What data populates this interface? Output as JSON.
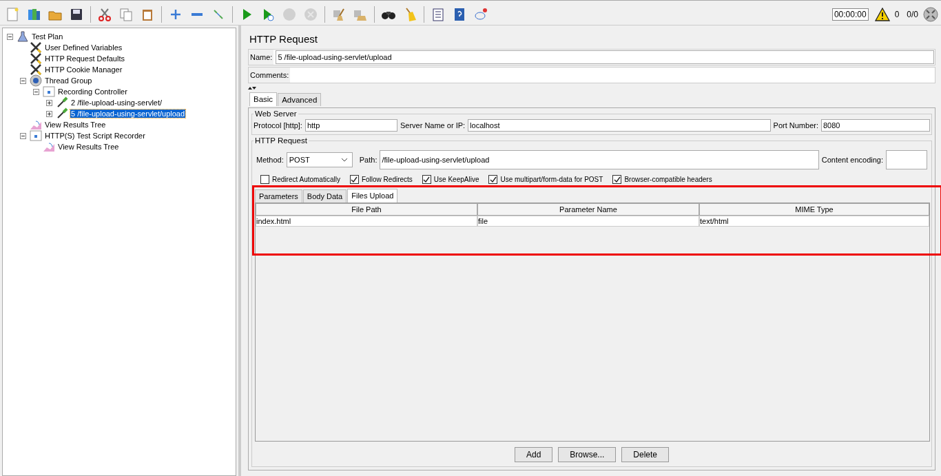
{
  "toolbar": {
    "buttons": [
      {
        "kind": "new",
        "disabled": false
      },
      {
        "kind": "templates",
        "disabled": false
      },
      {
        "kind": "open",
        "disabled": false
      },
      {
        "kind": "save",
        "disabled": false
      },
      {
        "kind": "separator"
      },
      {
        "kind": "cut",
        "disabled": false
      },
      {
        "kind": "copy",
        "disabled": false
      },
      {
        "kind": "paste",
        "disabled": false
      },
      {
        "kind": "separator"
      },
      {
        "kind": "expand",
        "disabled": false
      },
      {
        "kind": "collapse",
        "disabled": false
      },
      {
        "kind": "toggle",
        "disabled": false
      },
      {
        "kind": "separator"
      },
      {
        "kind": "start",
        "disabled": false
      },
      {
        "kind": "start-no-pause",
        "disabled": false
      },
      {
        "kind": "stop",
        "disabled": true
      },
      {
        "kind": "shutdown",
        "disabled": true
      },
      {
        "kind": "separator"
      },
      {
        "kind": "clear",
        "disabled": false
      },
      {
        "kind": "clear-all",
        "disabled": false
      },
      {
        "kind": "separator"
      },
      {
        "kind": "search",
        "disabled": false
      },
      {
        "kind": "reset-search",
        "disabled": false
      },
      {
        "kind": "separator"
      },
      {
        "kind": "function-helper",
        "disabled": false
      },
      {
        "kind": "help",
        "disabled": false
      },
      {
        "kind": "remote",
        "disabled": false
      }
    ],
    "timer": "00:00:00",
    "warnings": "0",
    "threads": "0/0"
  },
  "tree": [
    {
      "label": "Test Plan",
      "kind": "plan",
      "selected": false,
      "expanded": true,
      "children": [
        {
          "label": "User Defined Variables",
          "kind": "config",
          "selected": false
        },
        {
          "label": "HTTP Request Defaults",
          "kind": "config",
          "selected": false
        },
        {
          "label": "HTTP Cookie Manager",
          "kind": "config",
          "selected": false
        },
        {
          "label": "Thread Group",
          "kind": "thread-group",
          "selected": false,
          "expanded": true,
          "children": [
            {
              "label": "Recording Controller",
              "kind": "controller",
              "selected": false,
              "expanded": true,
              "children": [
                {
                  "label": "2 /file-upload-using-servlet/",
                  "kind": "sampler",
                  "selected": false,
                  "expanded": false
                },
                {
                  "label": "5 /file-upload-using-servlet/upload",
                  "kind": "sampler",
                  "selected": true,
                  "expanded": false
                }
              ]
            }
          ]
        },
        {
          "label": "View Results Tree",
          "kind": "listener",
          "selected": false
        },
        {
          "label": "HTTP(S) Test Script Recorder",
          "kind": "controller",
          "selected": false,
          "expanded": true,
          "children": [
            {
              "label": "View Results Tree",
              "kind": "listener",
              "selected": false
            }
          ]
        }
      ]
    }
  ],
  "panel": {
    "title": "HTTP Request",
    "name_label": "Name:",
    "name_value": "5 /file-upload-using-servlet/upload",
    "comments_label": "Comments:",
    "tabs": [
      {
        "label": "Basic",
        "selected": true
      },
      {
        "label": "Advanced",
        "selected": false
      }
    ],
    "web_server": {
      "legend": "Web Server",
      "protocol_label": "Protocol [http]:",
      "protocol": "http",
      "server_label": "Server Name or IP:",
      "server": "localhost",
      "port_label": "Port Number:",
      "port": "8080"
    },
    "http_request": {
      "legend": "HTTP Request",
      "method_label": "Method:",
      "method": "POST",
      "path_label": "Path:",
      "path": "/file-upload-using-servlet/upload",
      "encoding_label": "Content encoding:",
      "options": [
        {
          "label": "Redirect Automatically",
          "checked": false
        },
        {
          "label": "Follow Redirects",
          "checked": true
        },
        {
          "label": "Use KeepAlive",
          "checked": true
        },
        {
          "label": "Use multipart/form-data for POST",
          "checked": true
        },
        {
          "label": "Browser-compatible headers",
          "checked": true
        }
      ],
      "tabs": [
        {
          "label": "Parameters",
          "selected": false
        },
        {
          "label": "Body Data",
          "selected": false
        },
        {
          "label": "Files Upload",
          "selected": true
        }
      ],
      "table": {
        "columns": [
          "File Path",
          "Parameter Name",
          "MIME Type"
        ],
        "rows": [
          [
            "index.html",
            "file",
            "text/html"
          ]
        ]
      },
      "buttons": [
        "Add",
        "Browse...",
        "Delete"
      ]
    }
  }
}
